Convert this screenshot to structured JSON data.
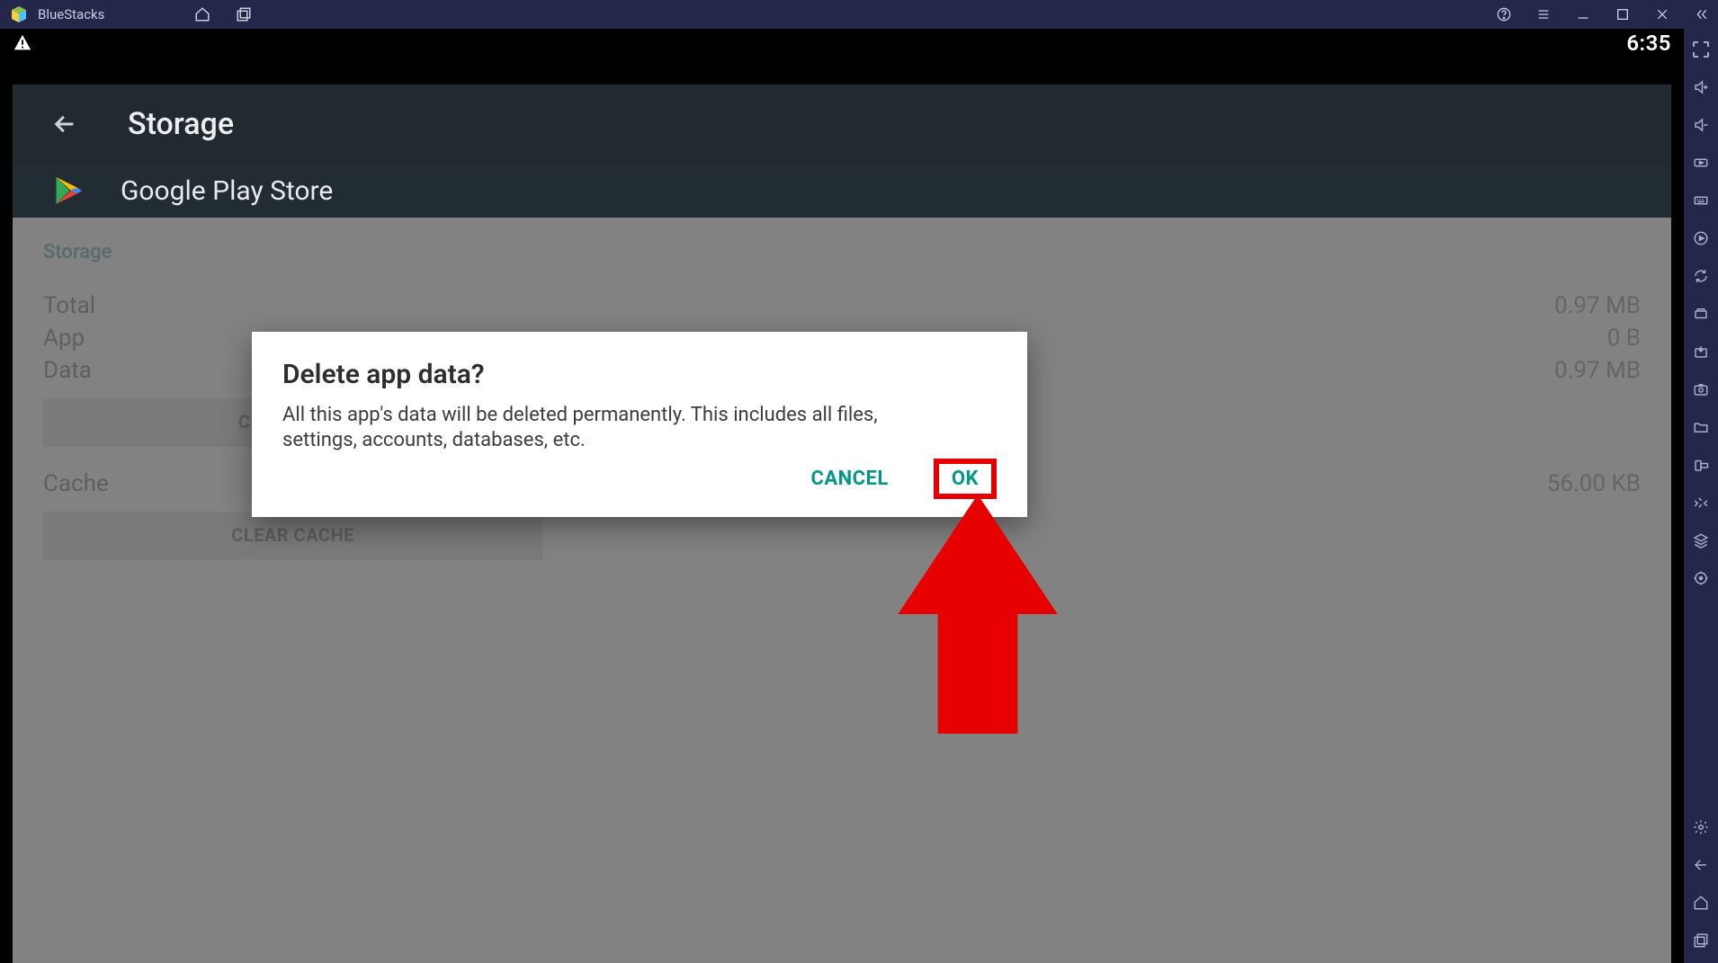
{
  "titlebar": {
    "product_name": "BlueStacks"
  },
  "statusbar": {
    "time": "6:35"
  },
  "header": {
    "title": "Storage"
  },
  "app_row": {
    "name": "Google Play Store"
  },
  "storage_section": {
    "label": "Storage",
    "rows": [
      {
        "label": "Total",
        "value": "0.97 MB"
      },
      {
        "label": "App",
        "value": "0 B"
      },
      {
        "label": "Data",
        "value": "0.97 MB"
      }
    ],
    "clear_data_label": "CLEAR DATA"
  },
  "cache_section": {
    "rows": [
      {
        "label": "Cache",
        "value": "56.00 KB"
      }
    ],
    "clear_cache_label": "CLEAR CACHE"
  },
  "dialog": {
    "title": "Delete app data?",
    "body": "All this app's data will be deleted permanently. This includes all files, settings, accounts, databases, etc.",
    "cancel_label": "CANCEL",
    "ok_label": "OK"
  },
  "colors": {
    "accent_teal": "#009688",
    "annotation_red": "#e70000",
    "titlebar_bg": "#25274a"
  }
}
